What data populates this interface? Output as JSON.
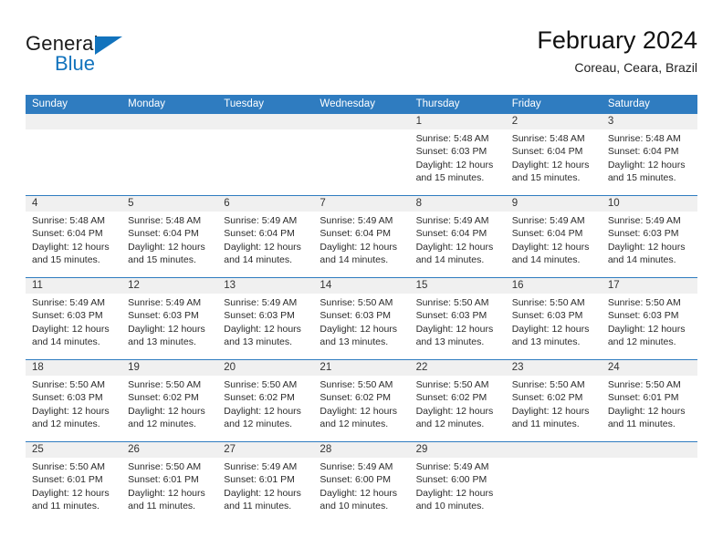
{
  "brand": {
    "name_top": "General",
    "name_bottom": "Blue",
    "triangle_color": "#1273bd",
    "text_color": "#1a1a1a"
  },
  "header": {
    "title": "February 2024",
    "subtitle": "Coreau, Ceara, Brazil"
  },
  "theme": {
    "header_blue": "#2f7cc0",
    "day_band_gray": "#f0f0f0",
    "cell_white": "#ffffff",
    "text": "#2b2b2b"
  },
  "weekdays": [
    "Sunday",
    "Monday",
    "Tuesday",
    "Wednesday",
    "Thursday",
    "Friday",
    "Saturday"
  ],
  "weeks": [
    [
      {
        "day": "",
        "empty": true,
        "sunrise": "",
        "sunset": "",
        "daylight1": "",
        "daylight2": ""
      },
      {
        "day": "",
        "empty": true,
        "sunrise": "",
        "sunset": "",
        "daylight1": "",
        "daylight2": ""
      },
      {
        "day": "",
        "empty": true,
        "sunrise": "",
        "sunset": "",
        "daylight1": "",
        "daylight2": ""
      },
      {
        "day": "",
        "empty": true,
        "sunrise": "",
        "sunset": "",
        "daylight1": "",
        "daylight2": ""
      },
      {
        "day": "1",
        "empty": false,
        "sunrise": "Sunrise: 5:48 AM",
        "sunset": "Sunset: 6:03 PM",
        "daylight1": "Daylight: 12 hours",
        "daylight2": "and 15 minutes."
      },
      {
        "day": "2",
        "empty": false,
        "sunrise": "Sunrise: 5:48 AM",
        "sunset": "Sunset: 6:04 PM",
        "daylight1": "Daylight: 12 hours",
        "daylight2": "and 15 minutes."
      },
      {
        "day": "3",
        "empty": false,
        "sunrise": "Sunrise: 5:48 AM",
        "sunset": "Sunset: 6:04 PM",
        "daylight1": "Daylight: 12 hours",
        "daylight2": "and 15 minutes."
      }
    ],
    [
      {
        "day": "4",
        "empty": false,
        "sunrise": "Sunrise: 5:48 AM",
        "sunset": "Sunset: 6:04 PM",
        "daylight1": "Daylight: 12 hours",
        "daylight2": "and 15 minutes."
      },
      {
        "day": "5",
        "empty": false,
        "sunrise": "Sunrise: 5:48 AM",
        "sunset": "Sunset: 6:04 PM",
        "daylight1": "Daylight: 12 hours",
        "daylight2": "and 15 minutes."
      },
      {
        "day": "6",
        "empty": false,
        "sunrise": "Sunrise: 5:49 AM",
        "sunset": "Sunset: 6:04 PM",
        "daylight1": "Daylight: 12 hours",
        "daylight2": "and 14 minutes."
      },
      {
        "day": "7",
        "empty": false,
        "sunrise": "Sunrise: 5:49 AM",
        "sunset": "Sunset: 6:04 PM",
        "daylight1": "Daylight: 12 hours",
        "daylight2": "and 14 minutes."
      },
      {
        "day": "8",
        "empty": false,
        "sunrise": "Sunrise: 5:49 AM",
        "sunset": "Sunset: 6:04 PM",
        "daylight1": "Daylight: 12 hours",
        "daylight2": "and 14 minutes."
      },
      {
        "day": "9",
        "empty": false,
        "sunrise": "Sunrise: 5:49 AM",
        "sunset": "Sunset: 6:04 PM",
        "daylight1": "Daylight: 12 hours",
        "daylight2": "and 14 minutes."
      },
      {
        "day": "10",
        "empty": false,
        "sunrise": "Sunrise: 5:49 AM",
        "sunset": "Sunset: 6:03 PM",
        "daylight1": "Daylight: 12 hours",
        "daylight2": "and 14 minutes."
      }
    ],
    [
      {
        "day": "11",
        "empty": false,
        "sunrise": "Sunrise: 5:49 AM",
        "sunset": "Sunset: 6:03 PM",
        "daylight1": "Daylight: 12 hours",
        "daylight2": "and 14 minutes."
      },
      {
        "day": "12",
        "empty": false,
        "sunrise": "Sunrise: 5:49 AM",
        "sunset": "Sunset: 6:03 PM",
        "daylight1": "Daylight: 12 hours",
        "daylight2": "and 13 minutes."
      },
      {
        "day": "13",
        "empty": false,
        "sunrise": "Sunrise: 5:49 AM",
        "sunset": "Sunset: 6:03 PM",
        "daylight1": "Daylight: 12 hours",
        "daylight2": "and 13 minutes."
      },
      {
        "day": "14",
        "empty": false,
        "sunrise": "Sunrise: 5:50 AM",
        "sunset": "Sunset: 6:03 PM",
        "daylight1": "Daylight: 12 hours",
        "daylight2": "and 13 minutes."
      },
      {
        "day": "15",
        "empty": false,
        "sunrise": "Sunrise: 5:50 AM",
        "sunset": "Sunset: 6:03 PM",
        "daylight1": "Daylight: 12 hours",
        "daylight2": "and 13 minutes."
      },
      {
        "day": "16",
        "empty": false,
        "sunrise": "Sunrise: 5:50 AM",
        "sunset": "Sunset: 6:03 PM",
        "daylight1": "Daylight: 12 hours",
        "daylight2": "and 13 minutes."
      },
      {
        "day": "17",
        "empty": false,
        "sunrise": "Sunrise: 5:50 AM",
        "sunset": "Sunset: 6:03 PM",
        "daylight1": "Daylight: 12 hours",
        "daylight2": "and 12 minutes."
      }
    ],
    [
      {
        "day": "18",
        "empty": false,
        "sunrise": "Sunrise: 5:50 AM",
        "sunset": "Sunset: 6:03 PM",
        "daylight1": "Daylight: 12 hours",
        "daylight2": "and 12 minutes."
      },
      {
        "day": "19",
        "empty": false,
        "sunrise": "Sunrise: 5:50 AM",
        "sunset": "Sunset: 6:02 PM",
        "daylight1": "Daylight: 12 hours",
        "daylight2": "and 12 minutes."
      },
      {
        "day": "20",
        "empty": false,
        "sunrise": "Sunrise: 5:50 AM",
        "sunset": "Sunset: 6:02 PM",
        "daylight1": "Daylight: 12 hours",
        "daylight2": "and 12 minutes."
      },
      {
        "day": "21",
        "empty": false,
        "sunrise": "Sunrise: 5:50 AM",
        "sunset": "Sunset: 6:02 PM",
        "daylight1": "Daylight: 12 hours",
        "daylight2": "and 12 minutes."
      },
      {
        "day": "22",
        "empty": false,
        "sunrise": "Sunrise: 5:50 AM",
        "sunset": "Sunset: 6:02 PM",
        "daylight1": "Daylight: 12 hours",
        "daylight2": "and 12 minutes."
      },
      {
        "day": "23",
        "empty": false,
        "sunrise": "Sunrise: 5:50 AM",
        "sunset": "Sunset: 6:02 PM",
        "daylight1": "Daylight: 12 hours",
        "daylight2": "and 11 minutes."
      },
      {
        "day": "24",
        "empty": false,
        "sunrise": "Sunrise: 5:50 AM",
        "sunset": "Sunset: 6:01 PM",
        "daylight1": "Daylight: 12 hours",
        "daylight2": "and 11 minutes."
      }
    ],
    [
      {
        "day": "25",
        "empty": false,
        "sunrise": "Sunrise: 5:50 AM",
        "sunset": "Sunset: 6:01 PM",
        "daylight1": "Daylight: 12 hours",
        "daylight2": "and 11 minutes."
      },
      {
        "day": "26",
        "empty": false,
        "sunrise": "Sunrise: 5:50 AM",
        "sunset": "Sunset: 6:01 PM",
        "daylight1": "Daylight: 12 hours",
        "daylight2": "and 11 minutes."
      },
      {
        "day": "27",
        "empty": false,
        "sunrise": "Sunrise: 5:49 AM",
        "sunset": "Sunset: 6:01 PM",
        "daylight1": "Daylight: 12 hours",
        "daylight2": "and 11 minutes."
      },
      {
        "day": "28",
        "empty": false,
        "sunrise": "Sunrise: 5:49 AM",
        "sunset": "Sunset: 6:00 PM",
        "daylight1": "Daylight: 12 hours",
        "daylight2": "and 10 minutes."
      },
      {
        "day": "29",
        "empty": false,
        "sunrise": "Sunrise: 5:49 AM",
        "sunset": "Sunset: 6:00 PM",
        "daylight1": "Daylight: 12 hours",
        "daylight2": "and 10 minutes."
      },
      {
        "day": "",
        "empty": true,
        "sunrise": "",
        "sunset": "",
        "daylight1": "",
        "daylight2": ""
      },
      {
        "day": "",
        "empty": true,
        "sunrise": "",
        "sunset": "",
        "daylight1": "",
        "daylight2": ""
      }
    ]
  ]
}
